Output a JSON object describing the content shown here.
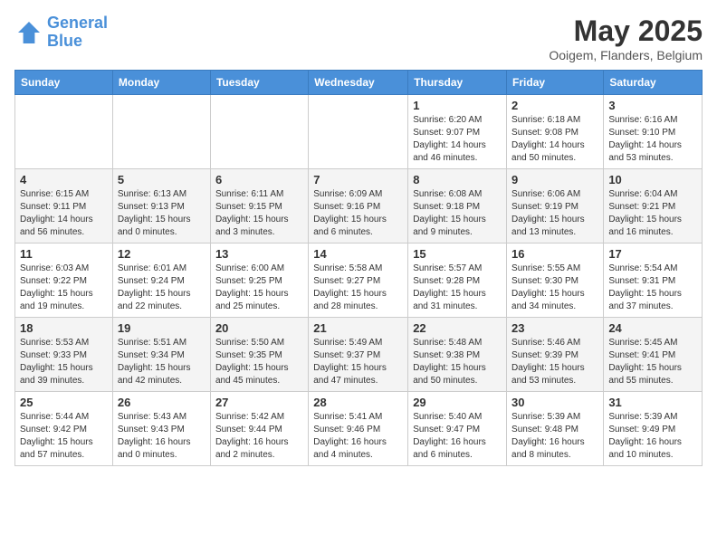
{
  "header": {
    "logo_line1": "General",
    "logo_line2": "Blue",
    "month": "May 2025",
    "location": "Ooigem, Flanders, Belgium"
  },
  "weekdays": [
    "Sunday",
    "Monday",
    "Tuesday",
    "Wednesday",
    "Thursday",
    "Friday",
    "Saturday"
  ],
  "weeks": [
    [
      {
        "day": "",
        "info": ""
      },
      {
        "day": "",
        "info": ""
      },
      {
        "day": "",
        "info": ""
      },
      {
        "day": "",
        "info": ""
      },
      {
        "day": "1",
        "info": "Sunrise: 6:20 AM\nSunset: 9:07 PM\nDaylight: 14 hours\nand 46 minutes."
      },
      {
        "day": "2",
        "info": "Sunrise: 6:18 AM\nSunset: 9:08 PM\nDaylight: 14 hours\nand 50 minutes."
      },
      {
        "day": "3",
        "info": "Sunrise: 6:16 AM\nSunset: 9:10 PM\nDaylight: 14 hours\nand 53 minutes."
      }
    ],
    [
      {
        "day": "4",
        "info": "Sunrise: 6:15 AM\nSunset: 9:11 PM\nDaylight: 14 hours\nand 56 minutes."
      },
      {
        "day": "5",
        "info": "Sunrise: 6:13 AM\nSunset: 9:13 PM\nDaylight: 15 hours\nand 0 minutes."
      },
      {
        "day": "6",
        "info": "Sunrise: 6:11 AM\nSunset: 9:15 PM\nDaylight: 15 hours\nand 3 minutes."
      },
      {
        "day": "7",
        "info": "Sunrise: 6:09 AM\nSunset: 9:16 PM\nDaylight: 15 hours\nand 6 minutes."
      },
      {
        "day": "8",
        "info": "Sunrise: 6:08 AM\nSunset: 9:18 PM\nDaylight: 15 hours\nand 9 minutes."
      },
      {
        "day": "9",
        "info": "Sunrise: 6:06 AM\nSunset: 9:19 PM\nDaylight: 15 hours\nand 13 minutes."
      },
      {
        "day": "10",
        "info": "Sunrise: 6:04 AM\nSunset: 9:21 PM\nDaylight: 15 hours\nand 16 minutes."
      }
    ],
    [
      {
        "day": "11",
        "info": "Sunrise: 6:03 AM\nSunset: 9:22 PM\nDaylight: 15 hours\nand 19 minutes."
      },
      {
        "day": "12",
        "info": "Sunrise: 6:01 AM\nSunset: 9:24 PM\nDaylight: 15 hours\nand 22 minutes."
      },
      {
        "day": "13",
        "info": "Sunrise: 6:00 AM\nSunset: 9:25 PM\nDaylight: 15 hours\nand 25 minutes."
      },
      {
        "day": "14",
        "info": "Sunrise: 5:58 AM\nSunset: 9:27 PM\nDaylight: 15 hours\nand 28 minutes."
      },
      {
        "day": "15",
        "info": "Sunrise: 5:57 AM\nSunset: 9:28 PM\nDaylight: 15 hours\nand 31 minutes."
      },
      {
        "day": "16",
        "info": "Sunrise: 5:55 AM\nSunset: 9:30 PM\nDaylight: 15 hours\nand 34 minutes."
      },
      {
        "day": "17",
        "info": "Sunrise: 5:54 AM\nSunset: 9:31 PM\nDaylight: 15 hours\nand 37 minutes."
      }
    ],
    [
      {
        "day": "18",
        "info": "Sunrise: 5:53 AM\nSunset: 9:33 PM\nDaylight: 15 hours\nand 39 minutes."
      },
      {
        "day": "19",
        "info": "Sunrise: 5:51 AM\nSunset: 9:34 PM\nDaylight: 15 hours\nand 42 minutes."
      },
      {
        "day": "20",
        "info": "Sunrise: 5:50 AM\nSunset: 9:35 PM\nDaylight: 15 hours\nand 45 minutes."
      },
      {
        "day": "21",
        "info": "Sunrise: 5:49 AM\nSunset: 9:37 PM\nDaylight: 15 hours\nand 47 minutes."
      },
      {
        "day": "22",
        "info": "Sunrise: 5:48 AM\nSunset: 9:38 PM\nDaylight: 15 hours\nand 50 minutes."
      },
      {
        "day": "23",
        "info": "Sunrise: 5:46 AM\nSunset: 9:39 PM\nDaylight: 15 hours\nand 53 minutes."
      },
      {
        "day": "24",
        "info": "Sunrise: 5:45 AM\nSunset: 9:41 PM\nDaylight: 15 hours\nand 55 minutes."
      }
    ],
    [
      {
        "day": "25",
        "info": "Sunrise: 5:44 AM\nSunset: 9:42 PM\nDaylight: 15 hours\nand 57 minutes."
      },
      {
        "day": "26",
        "info": "Sunrise: 5:43 AM\nSunset: 9:43 PM\nDaylight: 16 hours\nand 0 minutes."
      },
      {
        "day": "27",
        "info": "Sunrise: 5:42 AM\nSunset: 9:44 PM\nDaylight: 16 hours\nand 2 minutes."
      },
      {
        "day": "28",
        "info": "Sunrise: 5:41 AM\nSunset: 9:46 PM\nDaylight: 16 hours\nand 4 minutes."
      },
      {
        "day": "29",
        "info": "Sunrise: 5:40 AM\nSunset: 9:47 PM\nDaylight: 16 hours\nand 6 minutes."
      },
      {
        "day": "30",
        "info": "Sunrise: 5:39 AM\nSunset: 9:48 PM\nDaylight: 16 hours\nand 8 minutes."
      },
      {
        "day": "31",
        "info": "Sunrise: 5:39 AM\nSunset: 9:49 PM\nDaylight: 16 hours\nand 10 minutes."
      }
    ]
  ]
}
